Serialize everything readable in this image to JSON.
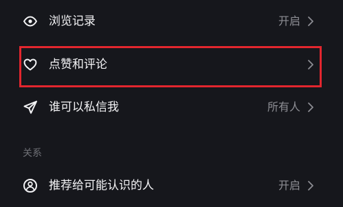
{
  "rows": {
    "browsing_history": {
      "label": "浏览记录",
      "value": "开启",
      "icon": "eye-icon"
    },
    "likes_comments": {
      "label": "点赞和评论",
      "value": "",
      "icon": "heart-icon"
    },
    "who_can_message": {
      "label": "谁可以私信我",
      "value": "所有人",
      "icon": "send-icon"
    },
    "recommend_to_acquaintances": {
      "label": "推荐给可能认识的人",
      "value": "开启",
      "icon": "person-circle-icon"
    }
  },
  "sections": {
    "relations_title": "关系"
  },
  "colors": {
    "background": "#16171c",
    "text": "#f3f3f5",
    "secondary_text": "#8d8e94",
    "highlight_border": "#e3262e"
  }
}
